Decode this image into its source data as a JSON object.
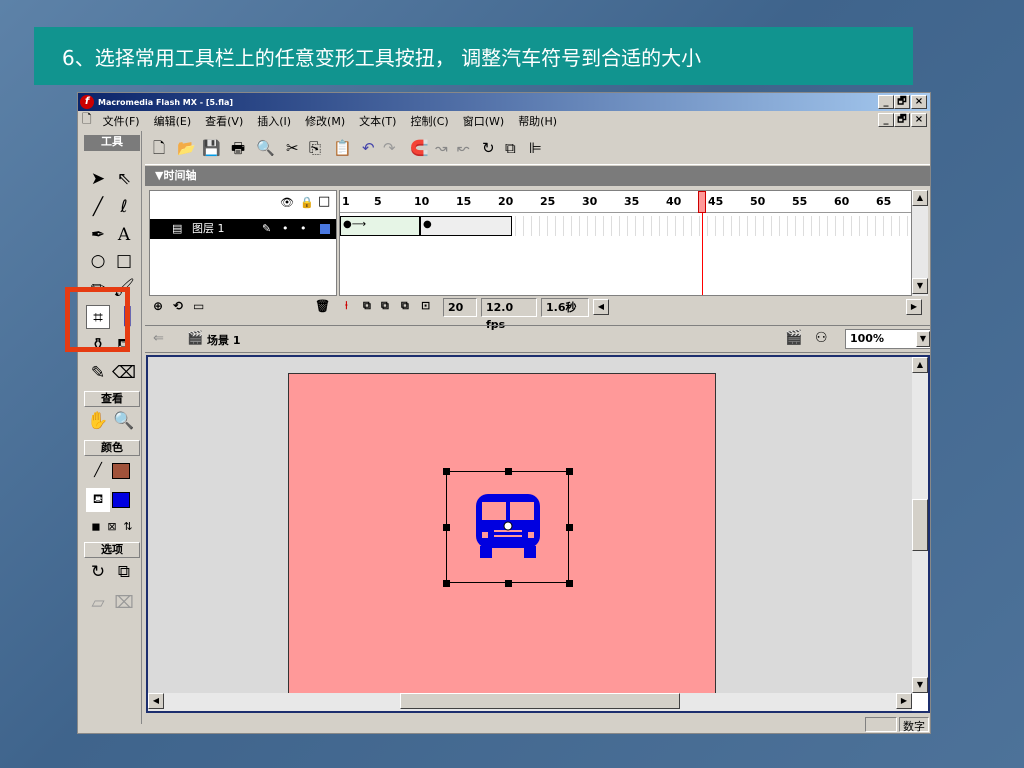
{
  "slide": {
    "caption": "6、选择常用工具栏上的任意变形工具按扭， 调整汽车符号到合适的大小"
  },
  "window": {
    "title": "Macromedia Flash MX - [5.fla]",
    "min": "_",
    "max": "🗗",
    "close": "×"
  },
  "menu": {
    "file_icon": "🗋",
    "items": [
      "文件(F)",
      "编辑(E)",
      "查看(V)",
      "插入(I)",
      "修改(M)",
      "文本(T)",
      "控制(C)",
      "窗口(W)",
      "帮助(H)"
    ]
  },
  "tools_panel": {
    "title": "工具",
    "view": "查看",
    "colors": "颜色",
    "options": "选项"
  },
  "timeline": {
    "title": "▼时间轴",
    "ruler": [
      "1",
      "5",
      "10",
      "15",
      "20",
      "25",
      "30",
      "35",
      "40",
      "45",
      "50",
      "55",
      "60",
      "65"
    ],
    "layer_name": "图层 1",
    "current_frame": "20",
    "fps": "12.0 fps",
    "time": "1.6秒"
  },
  "scene": {
    "name": "场景 1",
    "zoom": "100%"
  },
  "status": {
    "indicator": "数字"
  },
  "colors": {
    "highlight": "#e63b12",
    "stage": "#ff9999",
    "bus": "#0000e0",
    "caption_bg": "#11948f"
  }
}
